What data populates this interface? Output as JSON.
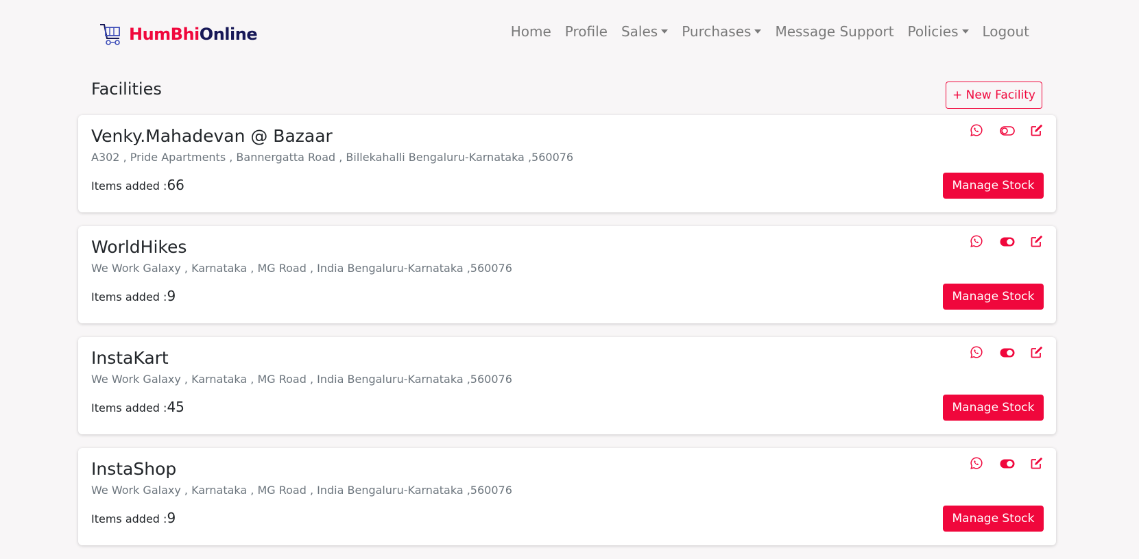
{
  "brand": {
    "part1": "HumBhi",
    "part2": "Online",
    "primary_color": "#f0073c",
    "secondary_color": "#171857"
  },
  "nav": {
    "items": [
      {
        "label": "Home",
        "dropdown": false
      },
      {
        "label": "Profile",
        "dropdown": false
      },
      {
        "label": "Sales",
        "dropdown": true
      },
      {
        "label": "Purchases",
        "dropdown": true
      },
      {
        "label": "Message Support",
        "dropdown": false
      },
      {
        "label": "Policies",
        "dropdown": true
      },
      {
        "label": "Logout",
        "dropdown": false
      }
    ]
  },
  "page": {
    "title": "Facilities",
    "new_button": "+ New Facility"
  },
  "facilities": [
    {
      "name": "Venky.Mahadevan @ Bazaar",
      "address": "A302 , Pride Apartments , Bannergatta Road , Billekahalli Bengaluru-Karnataka ,560076",
      "items_label": "Items added :",
      "items_count": "66",
      "active": false,
      "manage_label": "Manage Stock"
    },
    {
      "name": "WorldHikes",
      "address": "We Work Galaxy , Karnataka , MG Road , India Bengaluru-Karnataka ,560076",
      "items_label": "Items added :",
      "items_count": "9",
      "active": true,
      "manage_label": "Manage Stock"
    },
    {
      "name": "InstaKart",
      "address": "We Work Galaxy , Karnataka , MG Road , India Bengaluru-Karnataka ,560076",
      "items_label": "Items added :",
      "items_count": "45",
      "active": true,
      "manage_label": "Manage Stock"
    },
    {
      "name": "InstaShop",
      "address": "We Work Galaxy , Karnataka , MG Road , India Bengaluru-Karnataka ,560076",
      "items_label": "Items added :",
      "items_count": "9",
      "active": true,
      "manage_label": "Manage Stock"
    }
  ],
  "icons": {
    "whatsapp": "whatsapp-icon",
    "toggle": "toggle-icon",
    "edit": "edit-icon"
  }
}
